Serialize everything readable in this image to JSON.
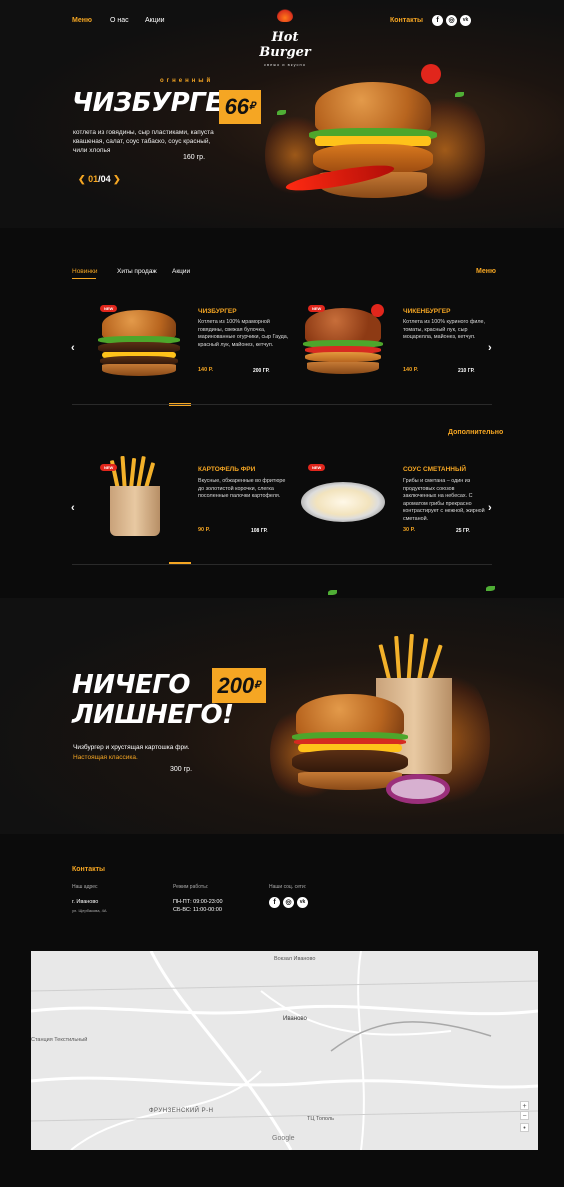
{
  "colors": {
    "accent": "#f5a623",
    "new_badge": "#e1261c",
    "background": "#0b0b0b"
  },
  "nav": {
    "items": [
      "Меню",
      "О нас",
      "Акции"
    ],
    "contacts": "Контакты"
  },
  "logo": {
    "name": "Hot Burger",
    "tagline": "свежо и вкусно"
  },
  "social": {
    "icons": [
      "facebook-icon",
      "instagram-icon",
      "vk-icon"
    ],
    "labels": [
      "f",
      "◎",
      "vk"
    ]
  },
  "hero": {
    "tag": "огненный",
    "title": "ЧИЗБУРГЕР",
    "price": "66",
    "currency": "₽",
    "description": "котлета из говядины, сыр пластиками, капуста квашеная, салат, соус табаско, соус красный, чили хлопья",
    "weight": "160 гр.",
    "slide_current": "01",
    "slide_total": "04"
  },
  "menu": {
    "tabs": [
      "Новинки",
      "Хиты продаж",
      "Акции"
    ],
    "section_title": "Меню",
    "items": [
      {
        "name": "ЧИЗБУРГЕР",
        "description": "Котлета из 100% мраморной говядины, свежая булочка, маринованные огурчики, сыр Гауда, красный лук, майонез, кетчуп.",
        "price": "140 Р.",
        "weight": "200 ГР.",
        "badge": "NEW"
      },
      {
        "name": "ЧИКЕНБУРГЕР",
        "description": "Котлета из 100% куриного филе, томаты, красный лук, сыр моцарелла, майонез, кетчуп.",
        "price": "140 Р.",
        "weight": "210 ГР.",
        "badge": "NEW"
      }
    ]
  },
  "extra": {
    "section_title": "Дополнительно",
    "items": [
      {
        "name": "КАРТОФЕЛЬ ФРИ",
        "description": "Вкусные, обжаренные во фритюре до золотистой корочки, слегка посоленные палочки картофеля.",
        "price": "90 Р.",
        "weight": "108 ГР.",
        "badge": "NEW"
      },
      {
        "name": "СОУС СМЕТАННЫЙ",
        "description": "Грибы и сметана – один из продуктовых союзов заключенных на небесах. С ароматом грибы прекрасно контрастирует с нежной, жирной сметаной.",
        "price": "30 Р.",
        "weight": "25 ГР.",
        "badge": "NEW"
      }
    ]
  },
  "promo": {
    "title_line1": "НИЧЕГО",
    "title_line2": "ЛИШНЕГО!",
    "price": "200",
    "currency": "₽",
    "text": "Чизбургер и хрустящая картошка фри.",
    "highlight": "Настоящая классика.",
    "weight": "300 гр."
  },
  "contacts": {
    "title": "Контакты",
    "address_label": "Наш адрес",
    "city": "г. Иваново",
    "street": "ул. Щербакова, 4А",
    "hours_label": "Режим работы:",
    "hours_1_days": "ПН-ПТ:",
    "hours_1_time": "09:00-23:00",
    "hours_2_days": "СБ-ВС:",
    "hours_2_time": "11:00-00:00",
    "social_label": "Наши соц. сети:"
  },
  "map": {
    "labels": [
      "Вокзал Иваново",
      "Иваново",
      "Станция Текстильный",
      "ФРУНЗЕНСКИЙ Р-Н",
      "ТЦ Тополь",
      "Google"
    ],
    "zoom_in": "+",
    "zoom_out": "−"
  }
}
